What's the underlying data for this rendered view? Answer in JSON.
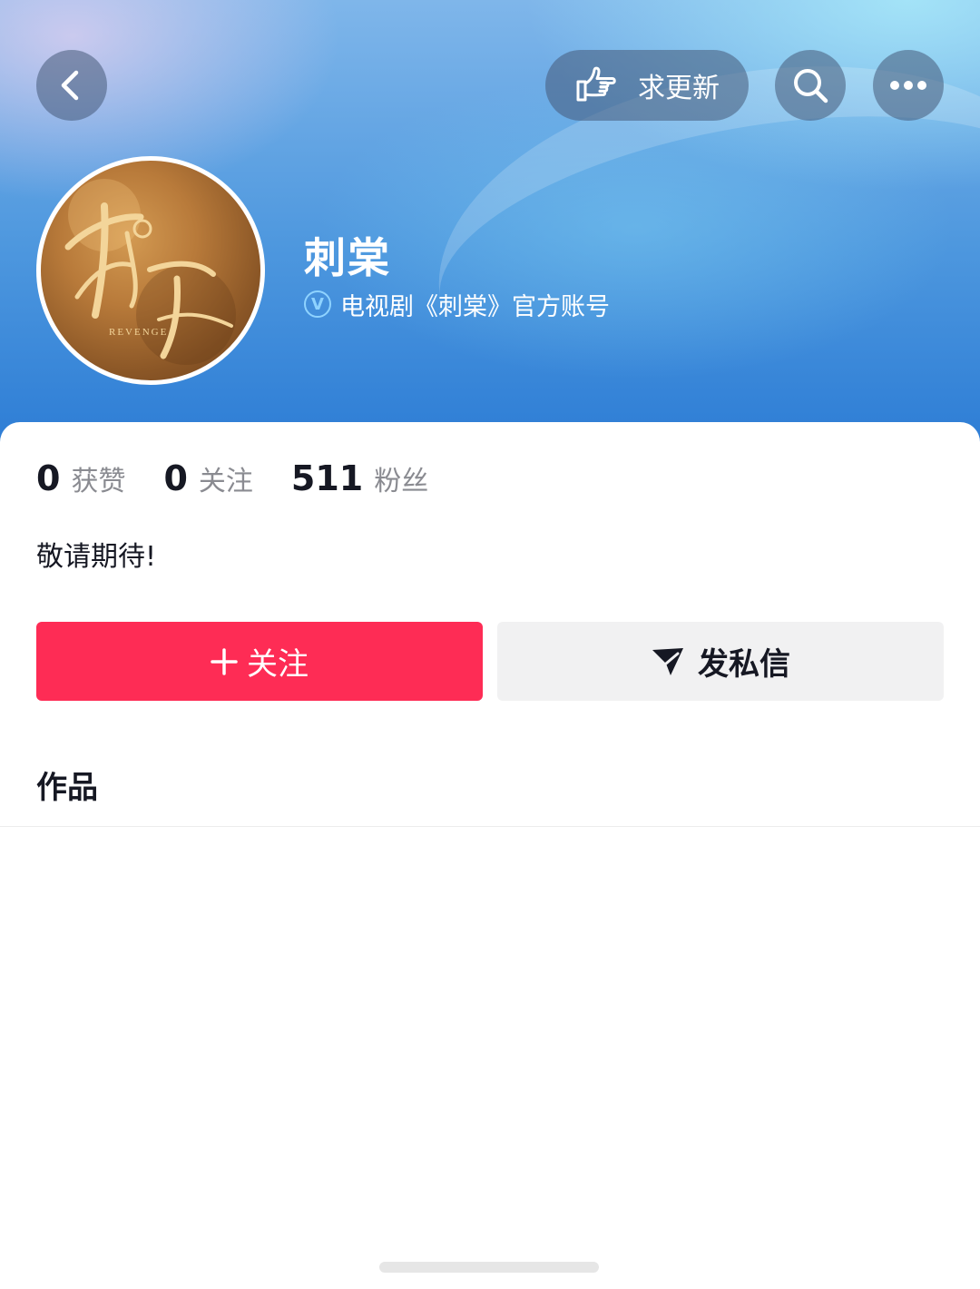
{
  "header": {
    "back_icon": "chevron-left-icon",
    "request_update_label": "求更新",
    "request_update_icon": "pointing-hand-icon",
    "search_icon": "search-icon",
    "more_icon": "more-dots-icon"
  },
  "profile": {
    "name": "刺棠",
    "verification": "电视剧《刺棠》官方账号",
    "verify_icon": "verified-v-icon",
    "avatar_text_en": "REVENGE"
  },
  "stats": [
    {
      "value": "0",
      "label": "获赞"
    },
    {
      "value": "0",
      "label": "关注"
    },
    {
      "value": "511",
      "label": "粉丝"
    }
  ],
  "bio": "敬请期待!",
  "actions": {
    "follow_label": "关注",
    "follow_icon": "plus-icon",
    "message_label": "发私信",
    "message_icon": "send-icon"
  },
  "tabs": {
    "works_label": "作品"
  },
  "colors": {
    "follow_button": "#fe2c55",
    "message_button": "#f1f1f2",
    "text_primary": "#161823",
    "text_secondary": "#8a8b91"
  }
}
